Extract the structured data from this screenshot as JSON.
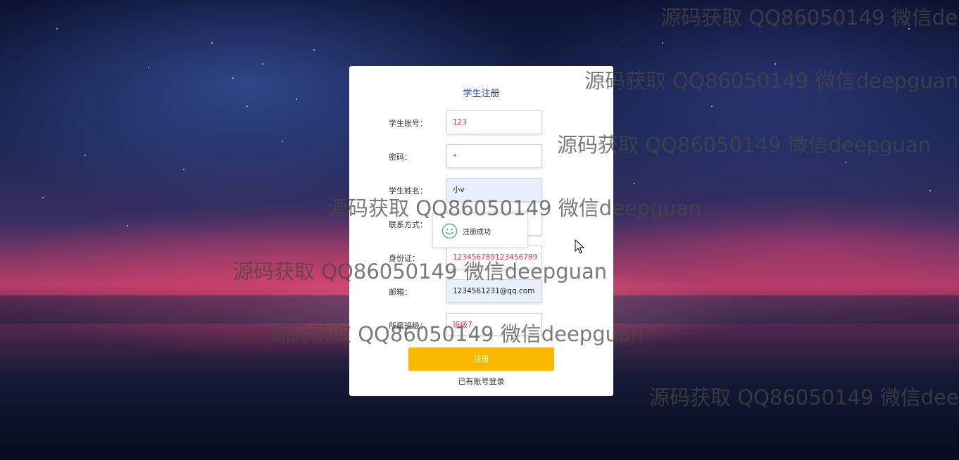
{
  "form": {
    "title": "学生注册",
    "fields": [
      {
        "label": "学生账号：",
        "value": "123"
      },
      {
        "label": "密码：",
        "value": "•"
      },
      {
        "label": "学生姓名：",
        "value": "小v"
      },
      {
        "label": "联系方式：",
        "value": ""
      },
      {
        "label": "身份证：",
        "value": "123456789123456789"
      },
      {
        "label": "邮箱：",
        "value": "1234561231@qq.com"
      },
      {
        "label": "所属班级：",
        "value": "班级7"
      }
    ],
    "submit_label": "注册",
    "login_link": "已有账号登录"
  },
  "toast": {
    "message": "注册成功",
    "icon": "smile-icon",
    "icon_color": "#5fb878"
  },
  "watermarks": [
    "源码获取 QQ86050149 微信deepguan",
    "源码获取 QQ86050149 微信deepguan",
    "源码获取 QQ86050149 微信deepguan",
    "源码获取 QQ86050149 微信deepguan",
    "源码获取 QQ86050149 微信deepguan",
    "源码获取 QQ86050149 微信deepguan",
    "源码获取 QQ86050149 微信deepguan"
  ],
  "colors": {
    "accent": "#fbb800",
    "title": "#1f3aa0",
    "input_text": "#e0393e"
  }
}
